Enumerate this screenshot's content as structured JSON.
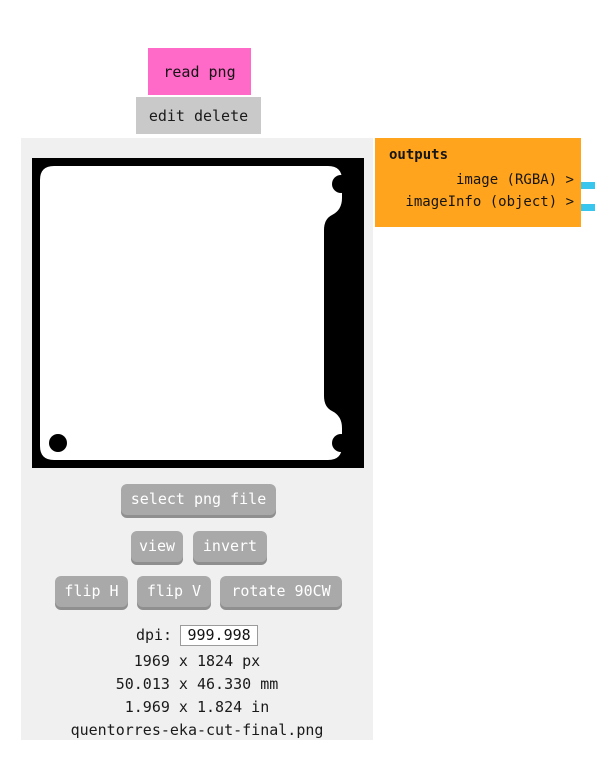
{
  "node": {
    "title": "read png",
    "actions": [
      "edit",
      "delete"
    ],
    "title_color": "#ff69c8",
    "action_bar_color": "#c9c9c9",
    "body_color": "#f0f0f0"
  },
  "preview": {
    "background": "#000000",
    "shape_color": "#ffffff",
    "alt": "png cut outline preview with four mounting holes and right side slot"
  },
  "buttons": {
    "select_png_file": "select png file",
    "view": "view",
    "invert": "invert",
    "flip_h": "flip H",
    "flip_v": "flip V",
    "rotate_90cw": "rotate 90CW",
    "color": "#a9a9a9"
  },
  "dpi": {
    "label": "dpi:",
    "value": "999.998",
    "placeholder": "dpi"
  },
  "info": {
    "pixels": "1969 x 1824 px",
    "millimeters": "50.013 x 46.330 mm",
    "inches": "1.969 x 1.824 in",
    "filename": "quentorres-eka-cut-final.png"
  },
  "outputs": {
    "title": "outputs",
    "ports": [
      {
        "label": "image (RGBA) >",
        "connector_color": "#38c6ef"
      },
      {
        "label": "imageInfo (object) >",
        "connector_color": "#38c6ef"
      }
    ],
    "panel_color": "#ffa41c"
  }
}
